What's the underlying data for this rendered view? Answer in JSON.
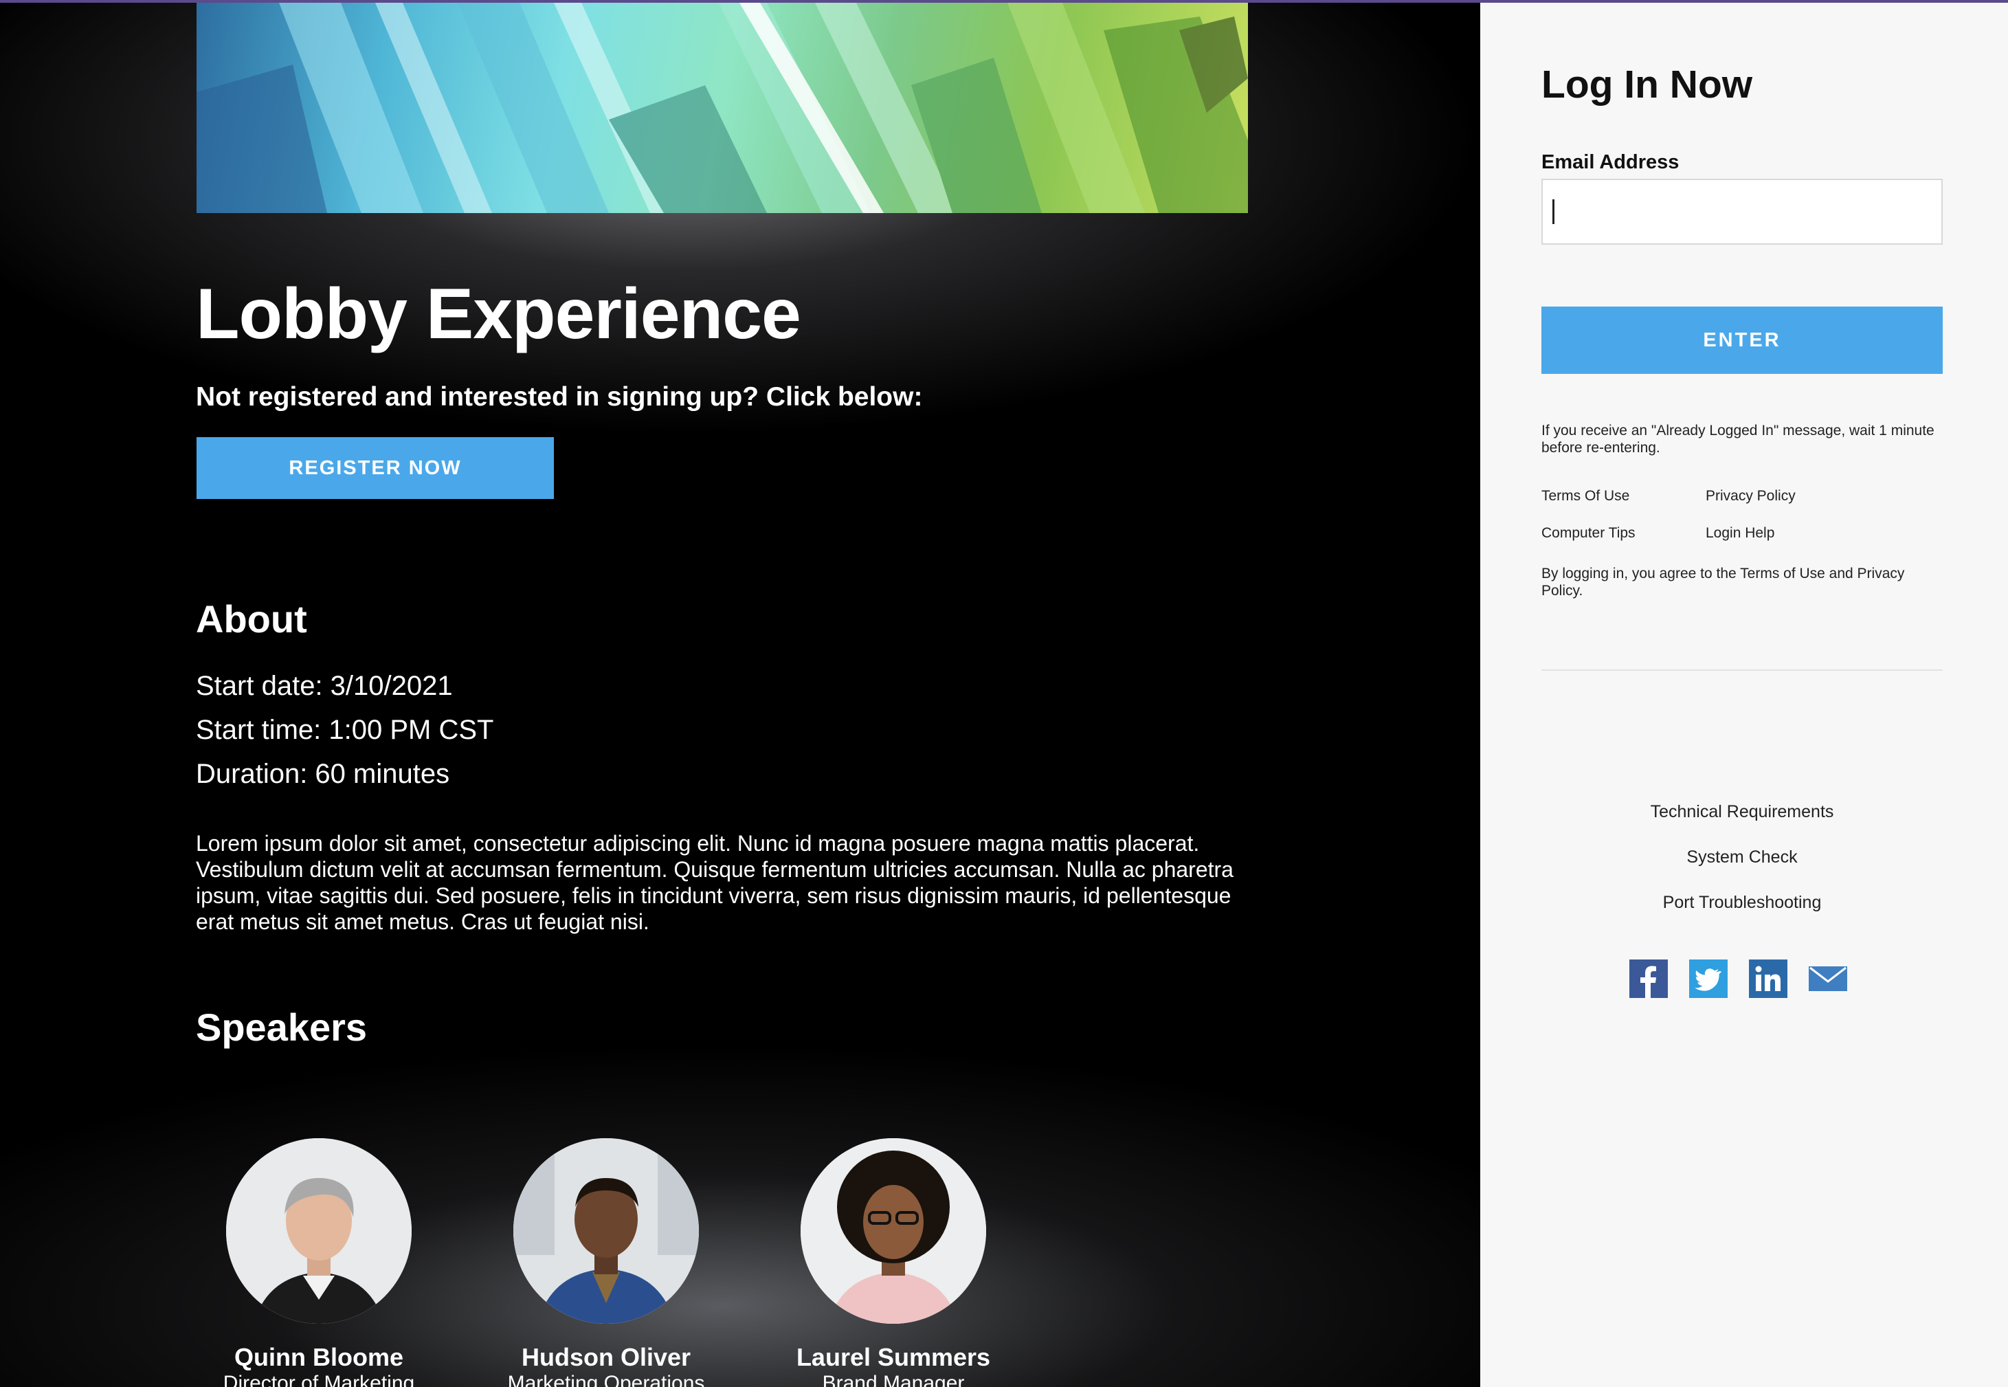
{
  "main": {
    "title": "Lobby Experience",
    "subtitle": "Not registered and interested in signing up? Click below:",
    "register_label": "REGISTER NOW",
    "about_heading": "About",
    "start_date": "Start date: 3/10/2021",
    "start_time": "Start time: 1:00 PM CST",
    "duration": "Duration: 60 minutes",
    "description": "Lorem ipsum dolor sit amet, consectetur adipiscing elit. Nunc id magna posuere magna mattis placerat. Vestibulum dictum velit at accumsan fermentum. Quisque fermentum ultricies accumsan. Nulla ac pharetra ipsum, vitae sagittis dui. Sed posuere, felis in tincidunt viverra, sem risus dignissim mauris, id pellentesque erat metus sit amet metus. Cras ut feugiat nisi.",
    "speakers_heading": "Speakers",
    "speakers": [
      {
        "name": "Quinn Bloome",
        "role": "Director of Marketing"
      },
      {
        "name": "Hudson Oliver",
        "role": "Marketing Operations"
      },
      {
        "name": "Laurel Summers",
        "role": "Brand Manager"
      }
    ]
  },
  "login": {
    "title": "Log In Now",
    "email_label": "Email Address",
    "email_value": "",
    "enter_label": "ENTER",
    "note": "If you receive an \"Already Logged In\" message, wait 1 minute before re-entering.",
    "links": {
      "terms": "Terms Of Use",
      "privacy": "Privacy Policy",
      "computer_tips": "Computer Tips",
      "login_help": "Login Help"
    },
    "agreement": "By logging in, you agree to the Terms of Use and Privacy Policy.",
    "center_links": [
      "Technical Requirements",
      "System Check",
      "Port Troubleshooting"
    ],
    "social": [
      "facebook-icon",
      "twitter-icon",
      "linkedin-icon",
      "email-icon"
    ]
  },
  "colors": {
    "accent": "#4aa8ea",
    "panel_bg": "#f7f7f7",
    "facebook": "#3b5998",
    "twitter": "#2f9fe0",
    "linkedin": "#2b6aa8",
    "email": "#3f7fc1"
  }
}
